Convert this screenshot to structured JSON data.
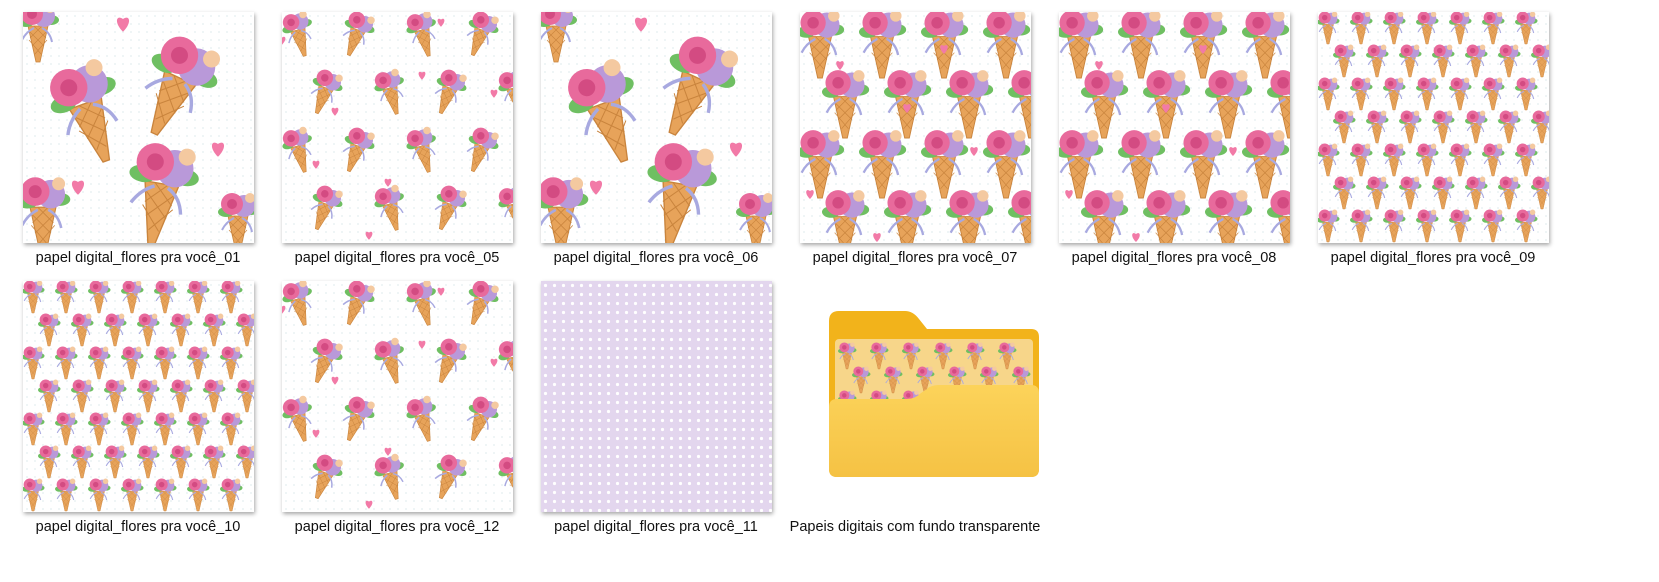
{
  "files": [
    {
      "name": "papel digital_flores pra você_01",
      "icon": "pattern-thumbnail-icon",
      "pattern": "large"
    },
    {
      "name": "papel digital_flores pra você_05",
      "icon": "pattern-thumbnail-icon",
      "pattern": "small-sparse"
    },
    {
      "name": "papel digital_flores pra você_06",
      "icon": "pattern-thumbnail-icon",
      "pattern": "large"
    },
    {
      "name": "papel digital_flores pra você_07",
      "icon": "pattern-thumbnail-icon",
      "pattern": "medium-dense"
    },
    {
      "name": "papel digital_flores pra você_08",
      "icon": "pattern-thumbnail-icon",
      "pattern": "medium-dense"
    },
    {
      "name": "papel digital_flores pra você_09",
      "icon": "pattern-thumbnail-icon",
      "pattern": "tiny-dense"
    },
    {
      "name": "papel digital_flores pra você_10",
      "icon": "pattern-thumbnail-icon",
      "pattern": "tiny-dense"
    },
    {
      "name": "papel digital_flores pra você_12",
      "icon": "pattern-thumbnail-icon",
      "pattern": "small-sparse"
    },
    {
      "name": "papel digital_flores pra você_11",
      "icon": "polka-dot-thumbnail-icon",
      "pattern": "lilac-dots"
    }
  ],
  "folder": {
    "name": "Papeis digitais com fundo transparente",
    "icon": "folder-icon"
  },
  "colors": {
    "folder_back": "#f2b31b",
    "folder_front": "#fcd35a",
    "folder_front_dark": "#f5c244",
    "pink": "#e86a9c",
    "lilac": "#b999d9",
    "cone": "#e7a35a",
    "leaf": "#6fbf62",
    "heart": "#f27aa7",
    "lilac_bg": "#e3d6ee",
    "dot": "#ffffff"
  }
}
